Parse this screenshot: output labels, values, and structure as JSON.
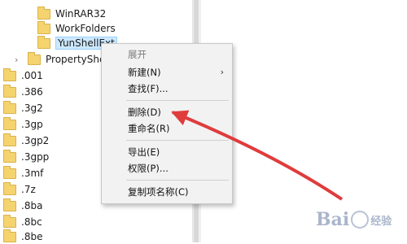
{
  "tree": {
    "subfolders": [
      {
        "label": "WinRAR32"
      },
      {
        "label": "WorkFolders"
      },
      {
        "label": "YunShellExt"
      }
    ],
    "sibling": {
      "label": "PropertyShee"
    },
    "extensions": [
      {
        "label": ".001"
      },
      {
        "label": ".386"
      },
      {
        "label": ".3g2"
      },
      {
        "label": ".3gp"
      },
      {
        "label": ".3gp2"
      },
      {
        "label": ".3gpp"
      },
      {
        "label": ".3mf"
      },
      {
        "label": ".7z"
      },
      {
        "label": ".8ba"
      },
      {
        "label": ".8bc"
      },
      {
        "label": ".8be"
      }
    ]
  },
  "context_menu": {
    "items": [
      {
        "label": "展开",
        "disabled": true
      },
      {
        "label": "新建(N)",
        "submenu": "›"
      },
      {
        "label": "查找(F)..."
      },
      {
        "label": "删除(D)"
      },
      {
        "label": "重命名(R)"
      },
      {
        "label": "导出(E)"
      },
      {
        "label": "权限(P)..."
      },
      {
        "label": "复制项名称(C)"
      }
    ]
  },
  "annotation": {
    "color": "#e03c3c"
  },
  "watermark": {
    "logo": "Bai",
    "suffix": "经验"
  }
}
